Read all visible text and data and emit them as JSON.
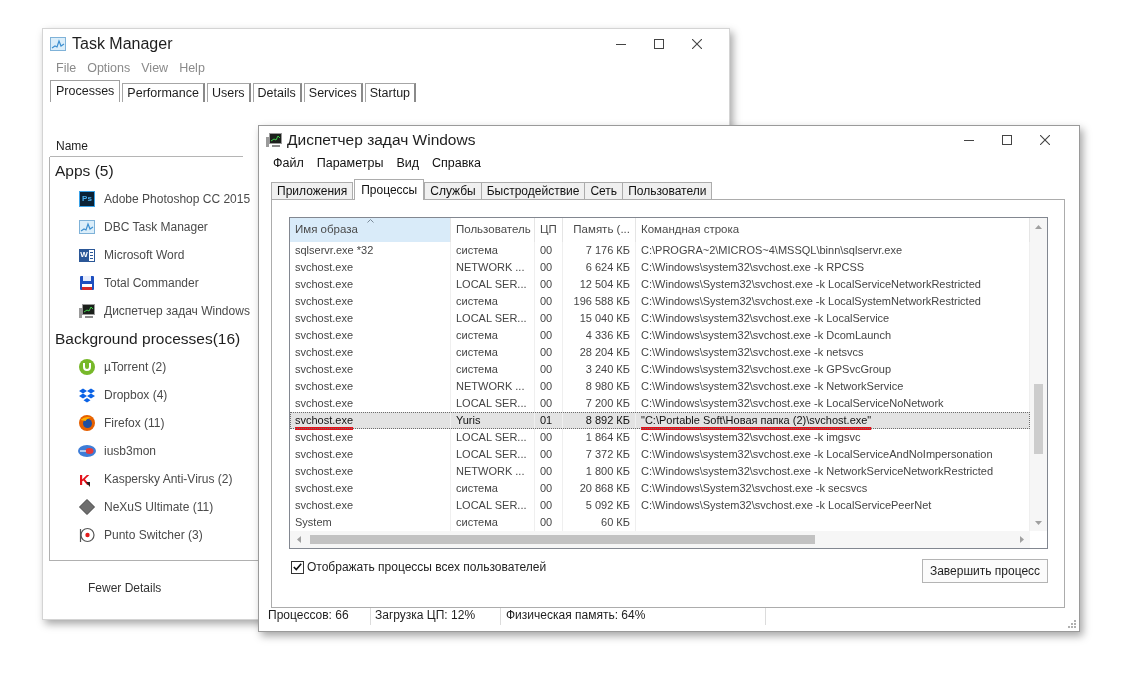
{
  "back_window": {
    "title": "Task Manager",
    "menu": [
      "File",
      "Options",
      "View",
      "Help"
    ],
    "tabs": [
      {
        "label": "Processes",
        "selected": true
      },
      {
        "label": "Performance",
        "selected": false
      },
      {
        "label": "Users",
        "selected": false
      },
      {
        "label": "Details",
        "selected": false
      },
      {
        "label": "Services",
        "selected": false
      },
      {
        "label": "Startup",
        "selected": false
      }
    ],
    "column_header": "Name",
    "groups": [
      {
        "title": "Apps (5)",
        "items": [
          {
            "name": "Adobe Photoshop CC 2015",
            "icon_text": "Ps"
          },
          {
            "name": "DBC Task Manager"
          },
          {
            "name": "Microsoft Word",
            "icon_text": "W"
          },
          {
            "name": "Total Commander"
          },
          {
            "name": "Диспетчер задач Windows"
          }
        ]
      },
      {
        "title": "Background processes(16)",
        "items": [
          {
            "name": "µTorrent (2)"
          },
          {
            "name": "Dropbox (4)"
          },
          {
            "name": "Firefox (11)"
          },
          {
            "name": "iusb3mon"
          },
          {
            "name": "Kaspersky Anti-Virus (2)",
            "icon_text": "K"
          },
          {
            "name": "NeXuS Ultimate (11)"
          },
          {
            "name": "Punto Switcher (3)"
          }
        ]
      }
    ],
    "footer_button": "Fewer Details"
  },
  "front_window": {
    "title": "Диспетчер задач Windows",
    "menu": [
      "Файл",
      "Параметры",
      "Вид",
      "Справка"
    ],
    "tabs": [
      {
        "label": "Приложения",
        "selected": false
      },
      {
        "label": "Процессы",
        "selected": true
      },
      {
        "label": "Службы",
        "selected": false
      },
      {
        "label": "Быстродействие",
        "selected": false
      },
      {
        "label": "Сеть",
        "selected": false
      },
      {
        "label": "Пользователи",
        "selected": false
      }
    ],
    "table": {
      "columns": [
        {
          "label": "Имя образа",
          "sorted": true
        },
        {
          "label": "Пользователь",
          "sorted": false
        },
        {
          "label": "ЦП",
          "sorted": false
        },
        {
          "label": "Память (...",
          "sorted": false
        },
        {
          "label": "Командная строка",
          "sorted": false
        }
      ],
      "rows": [
        {
          "cells": [
            "sqlservr.exe *32",
            "система",
            "00",
            "7 176 КБ",
            "C:\\PROGRA~2\\MICROS~4\\MSSQL\\binn\\sqlservr.exe"
          ],
          "selected": false,
          "underlined": false
        },
        {
          "cells": [
            "svchost.exe",
            "NETWORK ...",
            "00",
            "6 624 КБ",
            "C:\\Windows\\system32\\svchost.exe -k RPCSS"
          ],
          "selected": false,
          "underlined": false
        },
        {
          "cells": [
            "svchost.exe",
            "LOCAL SER...",
            "00",
            "12 504 КБ",
            "C:\\Windows\\System32\\svchost.exe -k LocalServiceNetworkRestricted"
          ],
          "selected": false,
          "underlined": false
        },
        {
          "cells": [
            "svchost.exe",
            "система",
            "00",
            "196 588 КБ",
            "C:\\Windows\\System32\\svchost.exe -k LocalSystemNetworkRestricted"
          ],
          "selected": false,
          "underlined": false
        },
        {
          "cells": [
            "svchost.exe",
            "LOCAL SER...",
            "00",
            "15 040 КБ",
            "C:\\Windows\\system32\\svchost.exe -k LocalService"
          ],
          "selected": false,
          "underlined": false
        },
        {
          "cells": [
            "svchost.exe",
            "система",
            "00",
            "4 336 КБ",
            "C:\\Windows\\system32\\svchost.exe -k DcomLaunch"
          ],
          "selected": false,
          "underlined": false
        },
        {
          "cells": [
            "svchost.exe",
            "система",
            "00",
            "28 204 КБ",
            "C:\\Windows\\system32\\svchost.exe -k netsvcs"
          ],
          "selected": false,
          "underlined": false
        },
        {
          "cells": [
            "svchost.exe",
            "система",
            "00",
            "3 240 КБ",
            "C:\\Windows\\system32\\svchost.exe -k GPSvcGroup"
          ],
          "selected": false,
          "underlined": false
        },
        {
          "cells": [
            "svchost.exe",
            "NETWORK ...",
            "00",
            "8 980 КБ",
            "C:\\Windows\\system32\\svchost.exe -k NetworkService"
          ],
          "selected": false,
          "underlined": false
        },
        {
          "cells": [
            "svchost.exe",
            "LOCAL SER...",
            "00",
            "7 200 КБ",
            "C:\\Windows\\system32\\svchost.exe -k LocalServiceNoNetwork"
          ],
          "selected": false,
          "underlined": false
        },
        {
          "cells": [
            "svchost.exe",
            "Yuris",
            "01",
            "8 892 КБ",
            "\"C:\\Portable Soft\\Новая папка (2)\\svchost.exe\""
          ],
          "selected": true,
          "underlined": true
        },
        {
          "cells": [
            "svchost.exe",
            "LOCAL SER...",
            "00",
            "1 864 КБ",
            "C:\\Windows\\system32\\svchost.exe -k imgsvc"
          ],
          "selected": false,
          "underlined": false
        },
        {
          "cells": [
            "svchost.exe",
            "LOCAL SER...",
            "00",
            "7 372 КБ",
            "C:\\Windows\\system32\\svchost.exe -k LocalServiceAndNoImpersonation"
          ],
          "selected": false,
          "underlined": false
        },
        {
          "cells": [
            "svchost.exe",
            "NETWORK ...",
            "00",
            "1 800 КБ",
            "C:\\Windows\\system32\\svchost.exe -k NetworkServiceNetworkRestricted"
          ],
          "selected": false,
          "underlined": false
        },
        {
          "cells": [
            "svchost.exe",
            "система",
            "00",
            "20 868 КБ",
            "C:\\Windows\\System32\\svchost.exe -k secsvcs"
          ],
          "selected": false,
          "underlined": false
        },
        {
          "cells": [
            "svchost.exe",
            "LOCAL SER...",
            "00",
            "5 092 КБ",
            "C:\\Windows\\System32\\svchost.exe -k LocalServicePeerNet"
          ],
          "selected": false,
          "underlined": false
        },
        {
          "cells": [
            "System",
            "система",
            "00",
            "60 КБ"
          ],
          "selected": false,
          "underlined": false
        }
      ]
    },
    "show_all_users": {
      "label": "Отображать процессы всех пользователей",
      "checked": true
    },
    "end_process_button": "Завершить процесс",
    "status_bar": [
      "Процессов: 66",
      "Загрузка ЦП: 12%",
      "Физическая память: 64%"
    ]
  }
}
